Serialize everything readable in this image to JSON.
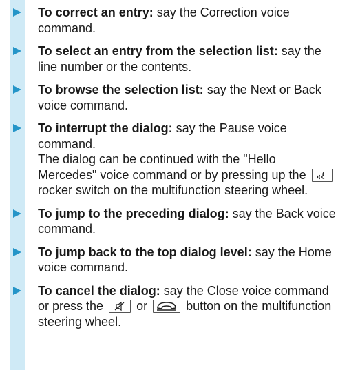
{
  "items": [
    {
      "lead": "To correct an entry:",
      "text": " say the Correction voice command."
    },
    {
      "lead": "To select an entry from the selection list:",
      "text": " say the line number or the contents."
    },
    {
      "lead": "To browse the selection list:",
      "text": " say the Next or Back voice command."
    },
    {
      "lead": "To interrupt the dialog:",
      "text": " say the Pause voice command.",
      "cont_a": "The dialog can be continued with the \"Hello Mercedes\" voice command or by pressing up the",
      "cont_b": "rocker switch on the multifunction steering wheel."
    },
    {
      "lead": "To jump to the preceding dialog:",
      "text": " say the Back voice command."
    },
    {
      "lead": "To jump back to the top dialog level:",
      "text": " say the Home voice command."
    },
    {
      "lead": "To cancel the dialog:",
      "text": " say the Close voice command or press the",
      "or": "or",
      "tail": "button on the multifunction steering wheel."
    }
  ],
  "icons": [
    "voice-control-icon",
    "mute-icon",
    "end-call-icon"
  ],
  "colors": {
    "accent_bar": "#cfeaf6",
    "bullet": "#2595c8"
  }
}
